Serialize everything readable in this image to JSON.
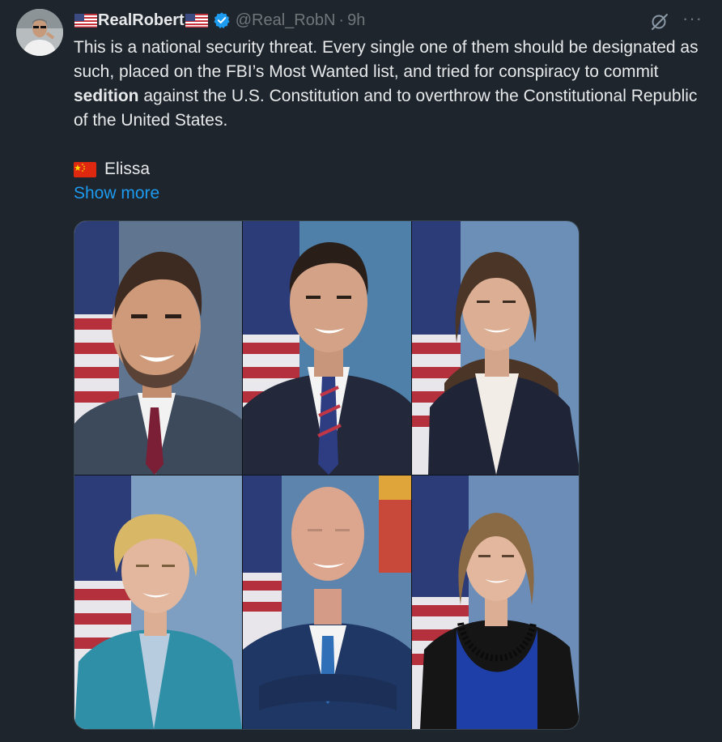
{
  "post": {
    "display_name": "RealRobert",
    "handle": "@Real_RobN",
    "separator": "·",
    "time": "9h",
    "text_part1": "This is a national security threat. Every single one of them should be designated as such, placed on the FBI’s Most Wanted list, and tried for conspiracy to commit ",
    "text_bold": "sedition",
    "text_part2": " against the U.S. Constitution and to overthrow the Constitutional Republic of the United States.",
    "signoff": "Elissa",
    "show_more": "Show more"
  },
  "icons": {
    "flag_left": "us-flag-icon",
    "flag_right": "us-flag-icon",
    "verified": "verified-badge-icon",
    "grok": "grok-icon",
    "more": "more-icon",
    "signoff_flag": "china-flag-icon"
  },
  "colors": {
    "background": "#1e252d",
    "text": "#e7e9ea",
    "muted": "#71767b",
    "link": "#1d9bf0",
    "verified": "#1d9bf0"
  },
  "media": {
    "count": 6,
    "photos": [
      {
        "description_icon": "portrait-man-dark-suit-red-tie"
      },
      {
        "description_icon": "portrait-man-navy-suit-striped-tie"
      },
      {
        "description_icon": "portrait-woman-navy-blazer"
      },
      {
        "description_icon": "portrait-woman-teal-blazer"
      },
      {
        "description_icon": "portrait-man-bald-navy-suit"
      },
      {
        "description_icon": "portrait-woman-black-blazer"
      }
    ]
  }
}
